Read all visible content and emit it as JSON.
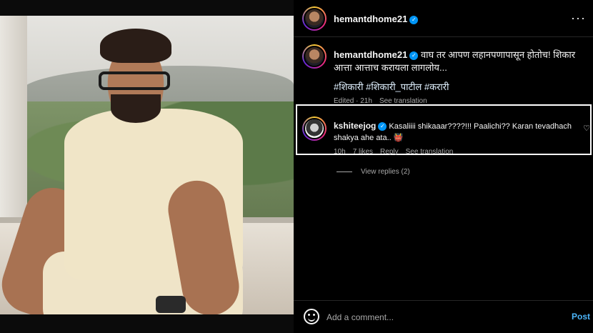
{
  "post": {
    "author": "hemantdhome21",
    "caption": "वाघ तर आपण लहानपणापासून होतोच! शिकार आत्ता आत्ताच करायला लागलोय...",
    "hashtags": "#शिकारी #शिकारी_पाटील #करारी",
    "edited": "Edited · 21h",
    "see_translation": "See translation",
    "more_icon": "more-options-icon"
  },
  "comment": {
    "author": "kshiteejog",
    "text": "Kasaliiii shikaaar????!!! Paalichi?? Karan tevadhach shakya ahe ata.. 👹",
    "time": "10h",
    "likes": "7 likes",
    "reply": "Reply",
    "see_translation": "See translation",
    "view_replies": "View replies (2)"
  },
  "footer": {
    "placeholder": "Add a comment...",
    "post_label": "Post"
  },
  "colors": {
    "background": "#000000",
    "link": "#4cb5f9",
    "verified": "#0095f6",
    "muted": "#a8a8a8"
  }
}
